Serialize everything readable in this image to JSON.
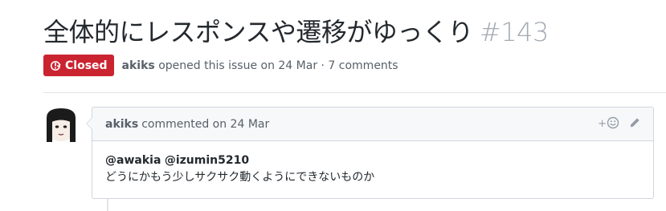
{
  "issue": {
    "title": "全体的にレスポンスや遷移がゆっくり",
    "number": "#143",
    "state": "Closed",
    "author": "akiks",
    "opened_text": "opened this issue on 24 Mar · 7 comments"
  },
  "comment": {
    "author": "akiks",
    "action_text": "commented on 24 Mar",
    "reaction_add_label": "+",
    "mentions": [
      "@awakia",
      "@izumin5210"
    ],
    "body": "どうにかもう少しサクサク動くようにできないものか"
  },
  "colors": {
    "closed_badge": "#cb2431",
    "issue_number": "#a3aab1",
    "header_bg": "#f6f8fa",
    "border": "#d1d5da"
  },
  "icons": {
    "state": "issue-closed-icon",
    "reaction": "smiley-icon",
    "edit": "pencil-icon"
  }
}
